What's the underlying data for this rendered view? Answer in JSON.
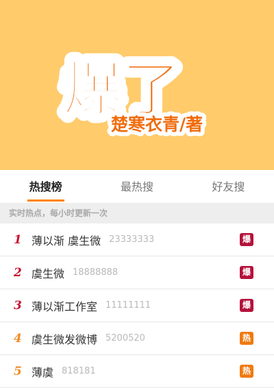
{
  "banner": {
    "title": "爆了",
    "author": "楚寒衣青/著",
    "colors": {
      "background": "#ffcb6b",
      "title_fill": "#f06d0e",
      "stroke": "#ffffff"
    }
  },
  "tabs": [
    {
      "label": "热搜榜",
      "active": true
    },
    {
      "label": "最热搜",
      "active": false
    },
    {
      "label": "好友搜",
      "active": false
    }
  ],
  "notice": "实时热点，每小时更新一次",
  "list": [
    {
      "rank": "1",
      "title": "薄以渐 虞生微",
      "count": "23333333",
      "badge": "爆",
      "rank_color": "#c8102e",
      "badge_color": "#b4123b"
    },
    {
      "rank": "2",
      "title": "虞生微",
      "count": "18888888",
      "badge": "爆",
      "rank_color": "#c8102e",
      "badge_color": "#b4123b"
    },
    {
      "rank": "3",
      "title": "薄以渐工作室",
      "count": "11111111",
      "badge": "爆",
      "rank_color": "#c8102e",
      "badge_color": "#b4123b"
    },
    {
      "rank": "4",
      "title": "虞生微发微博",
      "count": "5200520",
      "badge": "热",
      "rank_color": "#f08a24",
      "badge_color": "#f07a10"
    },
    {
      "rank": "5",
      "title": "薄虞",
      "count": "818181",
      "badge": "热",
      "rank_color": "#f08a24",
      "badge_color": "#f07a10"
    }
  ]
}
